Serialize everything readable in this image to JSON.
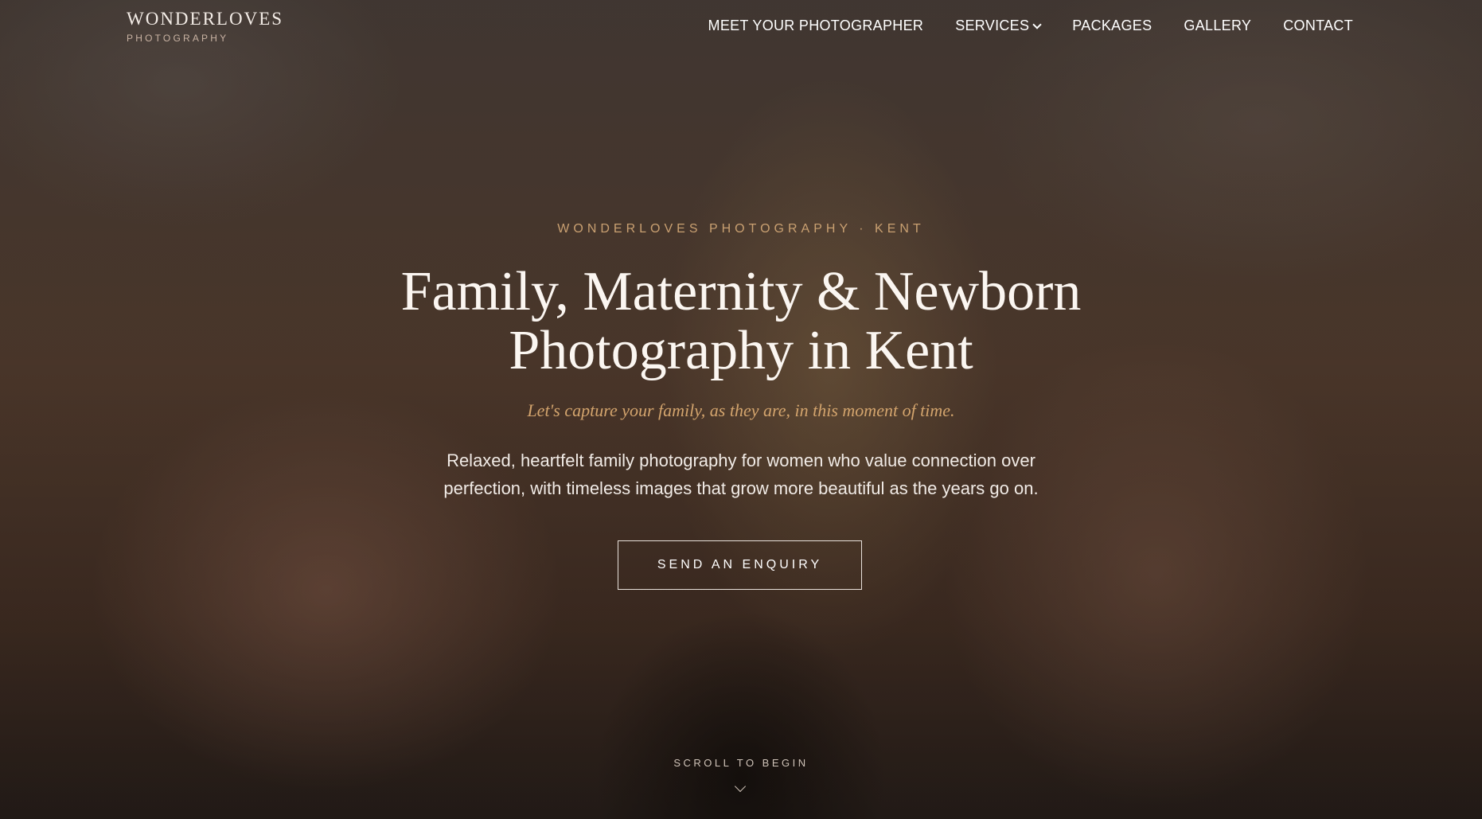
{
  "brand": {
    "name": "WONDERLOVES",
    "subtitle": "PHOTOGRAPHY"
  },
  "nav": {
    "items": [
      {
        "label": "MEET YOUR PHOTOGRAPHER"
      },
      {
        "label": "SERVICES",
        "icon": "chevron-down-icon"
      },
      {
        "label": "PACKAGES"
      },
      {
        "label": "GALLERY"
      },
      {
        "label": "CONTACT"
      }
    ]
  },
  "hero": {
    "eyebrow": "WONDERLOVES PHOTOGRAPHY · KENT",
    "headline_line1": "Family, Maternity & Newborn",
    "headline_line2": "Photography in Kent",
    "tagline": "Let's capture your family, as they are, in this moment of time.",
    "description_line1": "Relaxed, heartfelt family photography for women who value connection over",
    "description_line2": "perfection, with timeless images that grow more beautiful as the years go on.",
    "cta_label": "SEND AN ENQUIRY",
    "scroll_label": "SCROLL TO BEGIN"
  },
  "colors": {
    "accent": "#c9a071",
    "tagline": "#d3a46d",
    "text": "#ffffff"
  }
}
